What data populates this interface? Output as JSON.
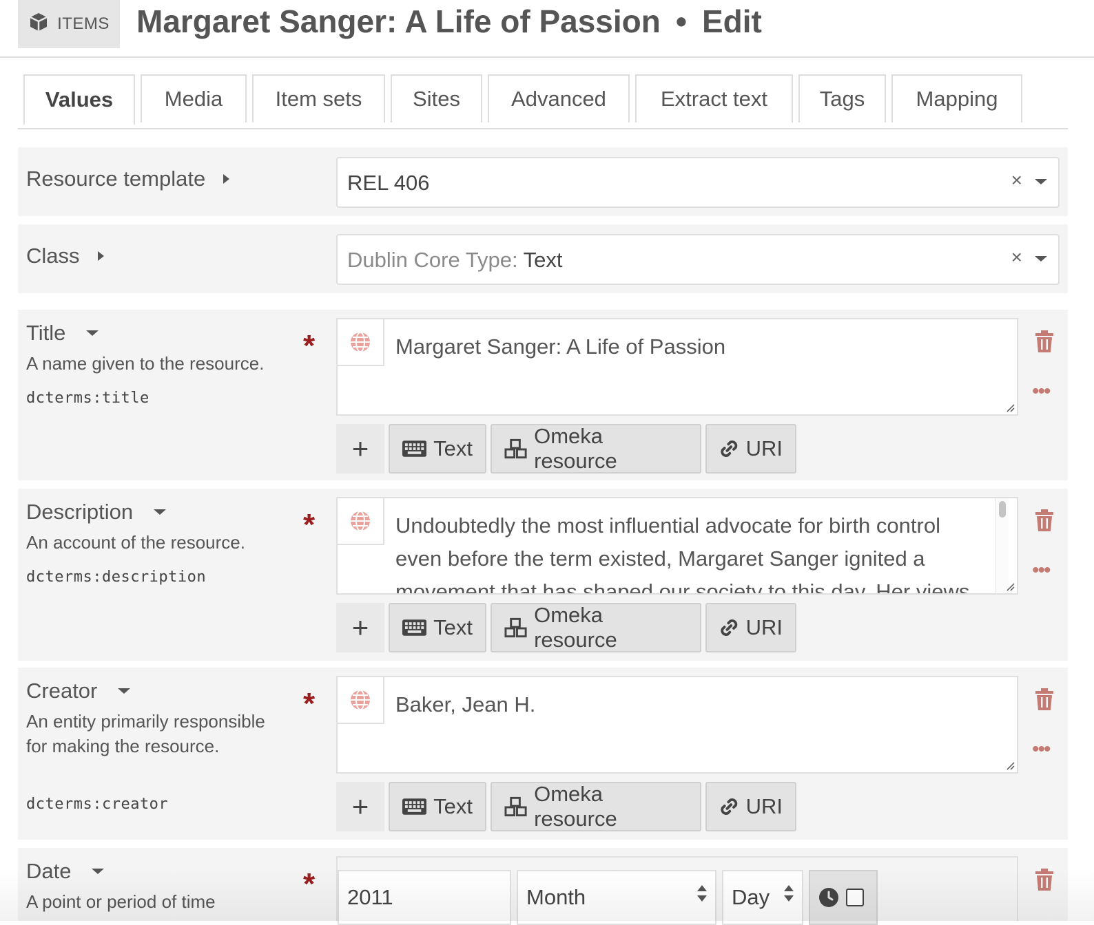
{
  "header": {
    "section_label": "ITEMS",
    "title": "Margaret Sanger: A Life of Passion",
    "separator": "•",
    "mode": "Edit"
  },
  "tabs": [
    {
      "label": "Values",
      "active": true
    },
    {
      "label": "Media"
    },
    {
      "label": "Item sets"
    },
    {
      "label": "Sites"
    },
    {
      "label": "Advanced"
    },
    {
      "label": "Extract text"
    },
    {
      "label": "Tags"
    },
    {
      "label": "Mapping"
    }
  ],
  "resource_template": {
    "label": "Resource template",
    "value": "REL 406",
    "clear": "×"
  },
  "resource_class": {
    "label": "Class",
    "prefix": "Dublin Core Type",
    "separator": ":",
    "value": "Text",
    "clear": "×"
  },
  "required_mark": "*",
  "value_types": {
    "plus": "+",
    "text": "Text",
    "resource": "Omeka resource",
    "uri": "URI"
  },
  "properties": [
    {
      "name": "Title",
      "description": "A name given to the resource.",
      "term": "dcterms:title",
      "value": "Margaret Sanger: A Life of Passion"
    },
    {
      "name": "Description",
      "description": "An account of the resource.",
      "term": "dcterms:description",
      "value": "Undoubtedly the most influential advocate for birth control even before the term existed, Margaret Sanger ignited a movement that has shaped our society to this day. Her views"
    },
    {
      "name": "Creator",
      "description": "An entity primarily responsible for making the resource.",
      "term": "dcterms:creator",
      "value": "Baker, Jean H."
    },
    {
      "name": "Date",
      "description": "A point or period of time",
      "year": "2011",
      "month": "Month",
      "day": "Day"
    }
  ],
  "more_icon": "•••",
  "colors": {
    "accent_red": "#9b1c1c",
    "action_red": "#c47b73",
    "row_bg": "#f4f4f4"
  }
}
